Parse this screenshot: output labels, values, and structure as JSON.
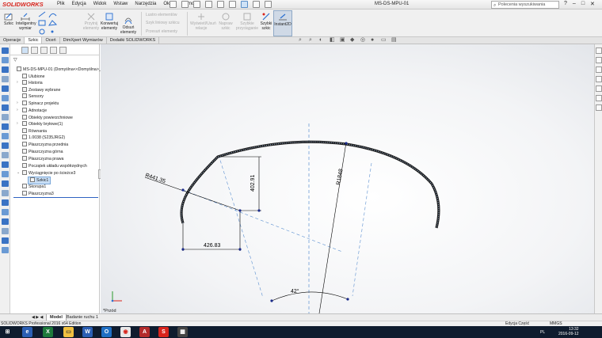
{
  "app": {
    "logo": "SOLIDWORKS",
    "document_title": "MS-DS-MPU-01"
  },
  "menu": [
    "Plik",
    "Edycja",
    "Widok",
    "Wstaw",
    "Narzędzia",
    "Okno",
    "Pomoc"
  ],
  "search": {
    "placeholder": "Polecenia wyszukiwania"
  },
  "commands": {
    "sketch": "Szkic",
    "smart_dim": "Inteligentny wymiar",
    "trim": "Przytnij elementy",
    "convert": "Konwertuj elementy",
    "offset": "Odsuń elementy",
    "mirror": "Lustro elementów",
    "linear_pattern": "Szyk liniowy szkicu",
    "move": "Przesuń elementy",
    "display_relations": "Wyświetl/Usuń relacje",
    "repair": "Napraw szkic",
    "quick_snaps": "Szybkie przyciąganie",
    "rapid_sketch": "Szybki szkic",
    "instant2d": "Instant2D"
  },
  "tabs": [
    "Operacje",
    "Szkic",
    "Oceń",
    "DimXpert Wymiarów",
    "Dodatki SOLIDWORKS"
  ],
  "active_tab": "Szkic",
  "tree": {
    "root": "MS-DS-MPU-01  (Domyślna<<Domyślna>_Sta",
    "items": [
      "Ulubione",
      "Historia",
      "Zestawy wybrane",
      "Sensory",
      "Spinacz projektu",
      "Adnotacje",
      "Obiekty powierzchniowe",
      "Obiekty bryłowe(1)",
      "Równania",
      "1.0038 (S235JRG2)",
      "Płaszczyzna przednia",
      "Płaszczyzna górna",
      "Płaszczyzna prawa",
      "Początek układu współrzędnych",
      "Wyciągnięcie po ścieżce3",
      "Szkic1",
      "Skorupa1",
      "Płaszczyzna3"
    ]
  },
  "sketch": {
    "dim_radius_small": "R441.35",
    "dim_radius_large": "R1848",
    "dim_vertical": "402.91",
    "dim_horizontal": "426.83",
    "dim_angle": "42°"
  },
  "view_name": "*Przód",
  "model_tabs": {
    "nav": "◀ ▶ ◀",
    "model": "Model",
    "study": "Badanie ruchu 1"
  },
  "status": {
    "edition": "SOLIDWORKS Professional 2016 x64 Edition",
    "mode": "Edycja Część",
    "units": "MMGS"
  },
  "taskbar": {
    "lang": "PL",
    "time": "13:32",
    "date": "2016-09-12"
  },
  "colors": {
    "brand": "#d8241c",
    "selection": "#c8def5",
    "dimension": "#000000",
    "sketch_point": "#1a2a8a",
    "centerline": "#5a8fd0"
  }
}
